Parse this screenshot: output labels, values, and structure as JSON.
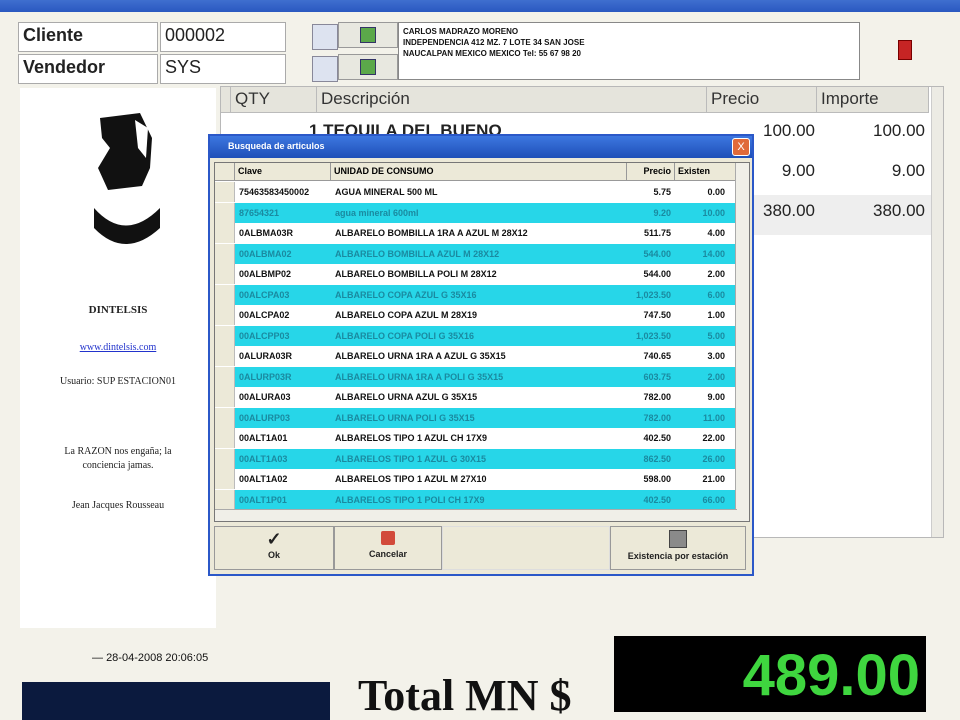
{
  "header": {
    "cliente_label": "Cliente",
    "cliente_value": "000002",
    "vendedor_label": "Vendedor",
    "vendedor_value": "SYS",
    "address_lines": [
      "CARLOS MADRAZO MORENO",
      "INDEPENDENCIA 412 MZ. 7 LOTE 34 SAN JOSE",
      "NAUCALPAN MEXICO MEXICO Tel: 55 67 98 20"
    ]
  },
  "left_panel": {
    "company": "DINTELSIS",
    "website": "www.dintelsis.com",
    "usuario": "Usuario: SUP ESTACION01",
    "quote_line1": "La RAZON nos engaña; la",
    "quote_line2": "conciencia jamas.",
    "quote_author": "Jean Jacques Rousseau"
  },
  "grid": {
    "headers": [
      "QTY",
      "Descripción",
      "Precio",
      "Importe"
    ],
    "rows": [
      {
        "desc": "1 TEQUILA DEL BUENO",
        "precio": "100.00",
        "importe": "100.00"
      },
      {
        "desc": "",
        "precio": "9.00",
        "importe": "9.00"
      },
      {
        "desc": "",
        "precio": "380.00",
        "importe": "380.00"
      }
    ]
  },
  "dialog": {
    "title": "Busqueda de articulos",
    "close_label": "X",
    "headers": [
      "Clave",
      "UNIDAD DE CONSUMO",
      "Precio",
      "Existen"
    ],
    "rows": [
      {
        "clave": "75463583450002",
        "desc": "AGUA MINERAL 500 ML",
        "precio": "5.75",
        "exist": "0.00",
        "alt": false
      },
      {
        "clave": "87654321",
        "desc": "agua mineral 600ml",
        "precio": "9.20",
        "exist": "10.00",
        "alt": true
      },
      {
        "clave": "0ALBMA03R",
        "desc": "ALBARELO BOMBILLA 1RA A AZUL M 28X12",
        "precio": "511.75",
        "exist": "4.00",
        "alt": false
      },
      {
        "clave": "00ALBMA02",
        "desc": "ALBARELO BOMBILLA AZUL M 28X12",
        "precio": "544.00",
        "exist": "14.00",
        "alt": true
      },
      {
        "clave": "00ALBMP02",
        "desc": "ALBARELO BOMBILLA POLI M 28X12",
        "precio": "544.00",
        "exist": "2.00",
        "alt": false
      },
      {
        "clave": "00ALCPA03",
        "desc": "ALBARELO COPA AZUL G 35X16",
        "precio": "1,023.50",
        "exist": "6.00",
        "alt": true
      },
      {
        "clave": "00ALCPA02",
        "desc": "ALBARELO COPA AZUL M 28X19",
        "precio": "747.50",
        "exist": "1.00",
        "alt": false
      },
      {
        "clave": "00ALCPP03",
        "desc": "ALBARELO COPA POLI G 35X16",
        "precio": "1,023.50",
        "exist": "5.00",
        "alt": true
      },
      {
        "clave": "0ALURA03R",
        "desc": "ALBARELO URNA 1RA A AZUL G 35X15",
        "precio": "740.65",
        "exist": "3.00",
        "alt": false
      },
      {
        "clave": "0ALURP03R",
        "desc": "ALBARELO URNA 1RA A POLI G 35X15",
        "precio": "603.75",
        "exist": "2.00",
        "alt": true
      },
      {
        "clave": "00ALURA03",
        "desc": "ALBARELO URNA AZUL G 35X15",
        "precio": "782.00",
        "exist": "9.00",
        "alt": false
      },
      {
        "clave": "00ALURP03",
        "desc": "ALBARELO URNA POLI G 35X15",
        "precio": "782.00",
        "exist": "11.00",
        "alt": true
      },
      {
        "clave": "00ALT1A01",
        "desc": "ALBARELOS TIPO 1 AZUL CH 17X9",
        "precio": "402.50",
        "exist": "22.00",
        "alt": false
      },
      {
        "clave": "00ALT1A03",
        "desc": "ALBARELOS TIPO 1 AZUL G 30X15",
        "precio": "862.50",
        "exist": "26.00",
        "alt": true
      },
      {
        "clave": "00ALT1A02",
        "desc": "ALBARELOS TIPO 1 AZUL M 27X10",
        "precio": "598.00",
        "exist": "21.00",
        "alt": false
      },
      {
        "clave": "00ALT1P01",
        "desc": "ALBARELOS TIPO 1 POLI CH 17X9",
        "precio": "402.50",
        "exist": "66.00",
        "alt": true
      }
    ],
    "ok_label": "Ok",
    "cancel_label": "Cancelar",
    "stock_label": "Existencia por estación"
  },
  "footer": {
    "datetime": "28-04-2008 20:06:05",
    "total_label": "Total MN $",
    "total_value": "489.00"
  }
}
